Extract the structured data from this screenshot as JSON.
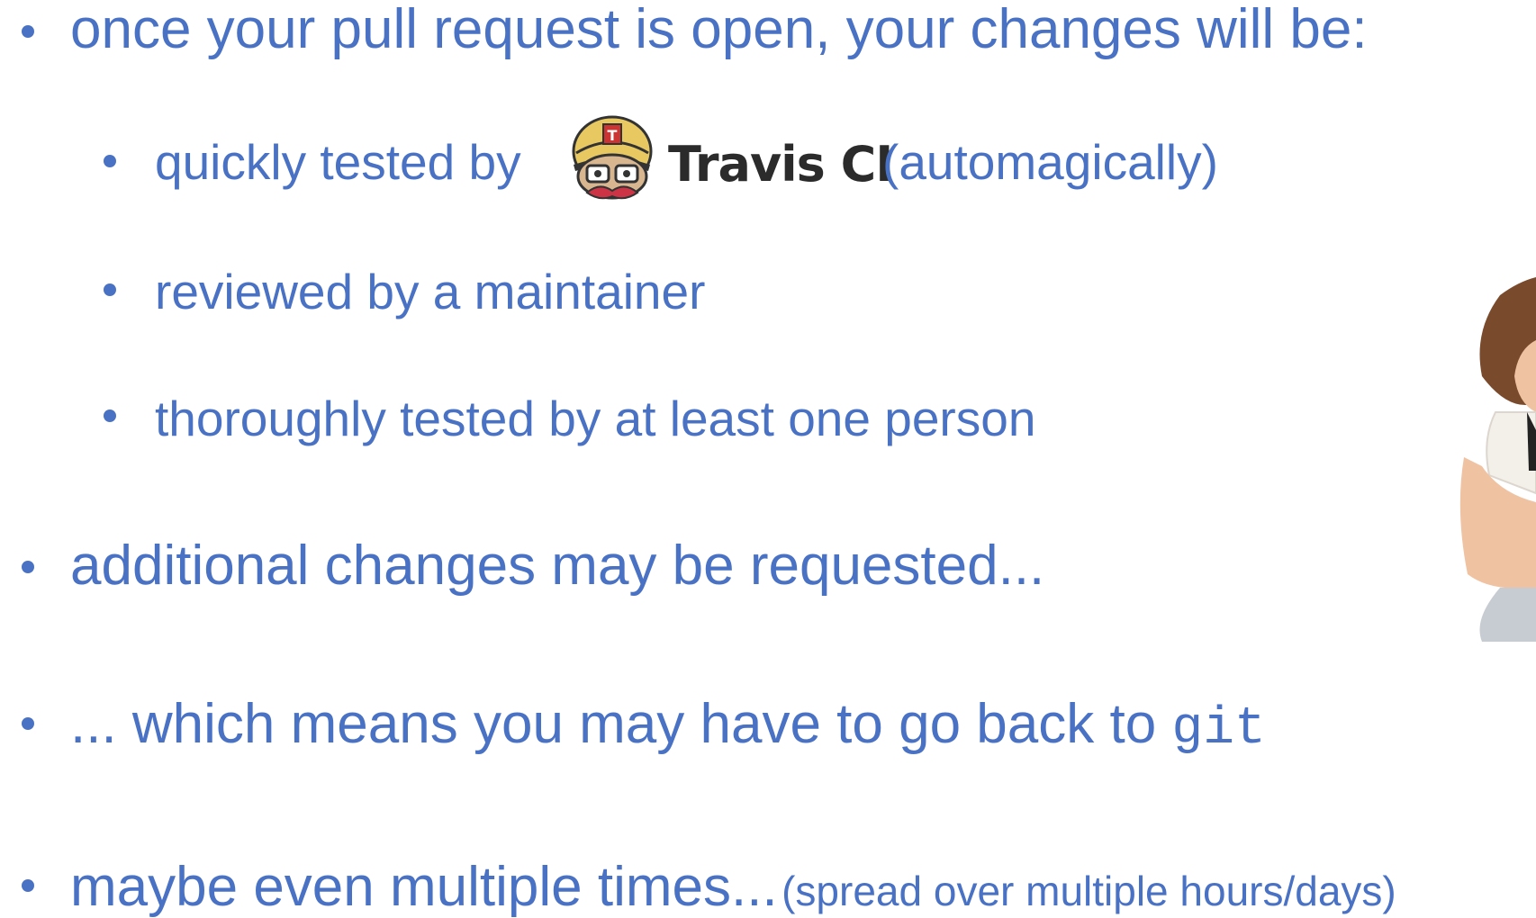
{
  "bullets": {
    "first": "once your pull request is open, your changes will be:",
    "sub1_prefix": "quickly tested by",
    "travis_name": "Travis CI",
    "sub1_suffix": "(automagically)",
    "sub2": "reviewed by a maintainer",
    "sub3": "thoroughly tested by at least one person",
    "second": "additional changes may be requested...",
    "third_prefix": "... which means you may have to go back to",
    "third_code": "git",
    "fourth_main": "maybe even multiple times...",
    "fourth_note": "(spread over multiple hours/days)"
  },
  "icons": {
    "travis": "travis-ci-mascot-icon",
    "person": "frustrated-person-photo"
  },
  "colors": {
    "text": "#4a72c4",
    "travis_text": "#2b2b2b"
  }
}
